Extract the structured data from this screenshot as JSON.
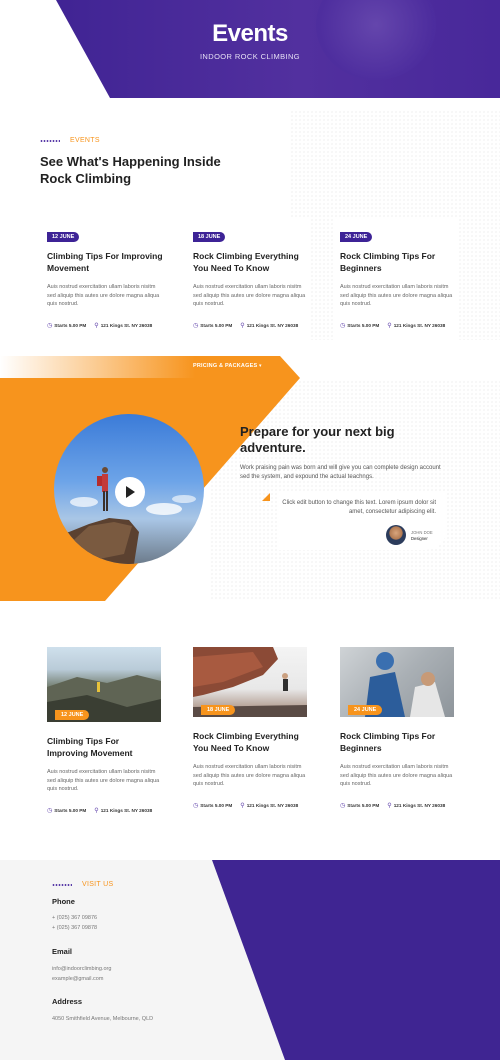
{
  "hero": {
    "title": "Events",
    "subtitle": "INDOOR ROCK CLIMBING"
  },
  "events_section": {
    "label": "EVENTS",
    "title": "See What's Happening Inside Rock Climbing"
  },
  "cards": [
    {
      "date": "12 JUNE",
      "title": "Climbing Tips For Improving Movement",
      "text": "Auis nostrud exercitation ullam laboris nisitm sed aliquip this autes ure dolore magna aliqua quis nostrud.",
      "time": "Starts 5.00 PM",
      "location": "121 Kings St. NY 26038"
    },
    {
      "date": "18 JUNE",
      "title": "Rock Climbing Everything You Need To Know",
      "text": "Auis nostrud exercitation ullam laboris nisitm sed aliquip this autes ure dolore magna aliqua quis nostrud.",
      "time": "Starts 5.00 PM",
      "location": "121 Kings St. NY 26038"
    },
    {
      "date": "24 JUNE",
      "title": "Rock Climbing Tips For Beginners",
      "text": "Auis nostrud exercitation ullam laboris nisitm sed aliquip this autes ure dolore magna aliqua quis nostrud.",
      "time": "Starts 5.00 PM",
      "location": "121 Kings St. NY 26038"
    }
  ],
  "pricing_link": "PRICING & PACKAGES",
  "adventure": {
    "title": "Prepare for your next big adventure.",
    "text": "Work praising pain was born and will give you can complete design account sed the system, and expound the actual teachngs.",
    "testimonial": "Click edit button to change this text. Lorem ipsum dolor sit amet, consectetur adipiscing elit.",
    "author_name": "JOHN DOE",
    "author_role": "Designer"
  },
  "image_cards": [
    {
      "date": "12 JUNE",
      "title": "Climbing Tips For Improving Movement",
      "text": "Auis nostrud exercitation ullam laboris nisitm sed aliquip this autes ure dolore magna aliqua quis nostrud.",
      "time": "Starts 5.00 PM",
      "location": "121 Kings St. NY 26038"
    },
    {
      "date": "18 JUNE",
      "title": "Rock Climbing Everything You Need To Know",
      "text": "Auis nostrud exercitation ullam laboris nisitm sed aliquip this autes ure dolore magna aliqua quis nostrud.",
      "time": "Starts 5.00 PM",
      "location": "121 Kings St. NY 26038"
    },
    {
      "date": "24 JUNE",
      "title": "Rock Climbing Tips For Beginners",
      "text": "Auis nostrud exercitation ullam laboris nisitm sed aliquip this autes ure dolore magna aliqua quis nostrud.",
      "time": "Starts 5.00 PM",
      "location": "121 Kings St. NY 26038"
    }
  ],
  "contact": {
    "label": "VISIT US",
    "phone_heading": "Phone",
    "phones": [
      "+ (025) 367 09876",
      "+ (025) 367 09878"
    ],
    "email_heading": "Email",
    "emails": [
      "info@indoorclimbing.org",
      "example@gmail.com"
    ],
    "address_heading": "Address",
    "address": "4050 Smithfield Avenue, Melbourne, QLD"
  },
  "colors": {
    "purple": "#3d2396",
    "orange": "#f7941d"
  },
  "icons": {
    "time": "clock-icon",
    "location": "map-pin-icon",
    "play": "play-icon"
  }
}
